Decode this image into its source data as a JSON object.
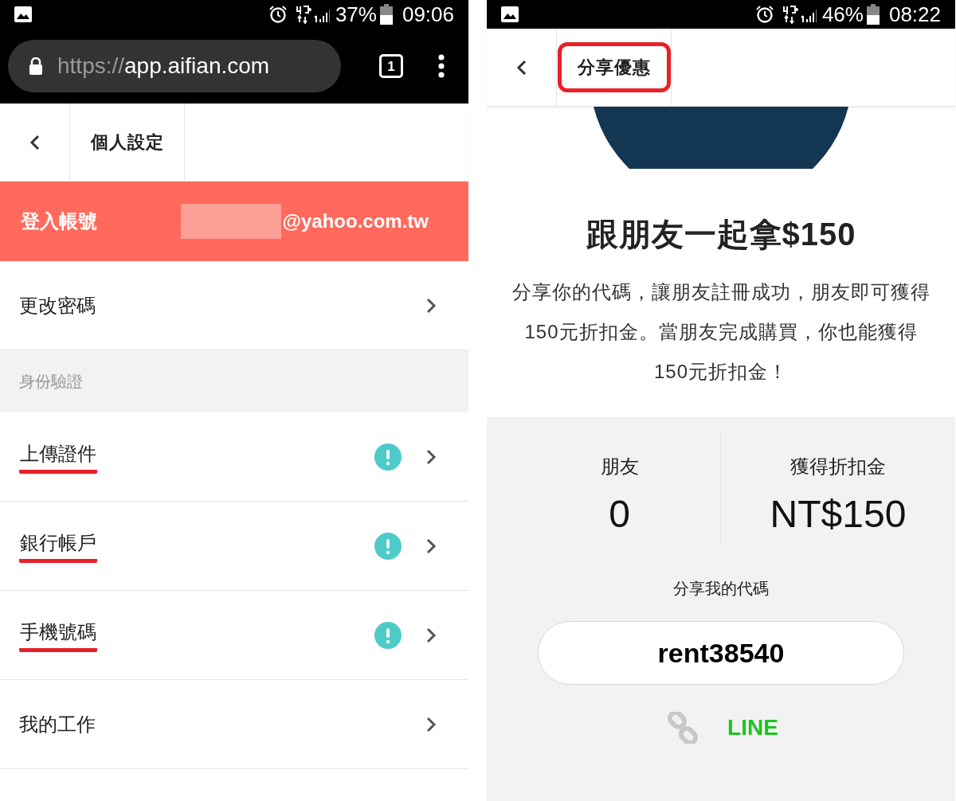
{
  "left_screen": {
    "status_bar": {
      "battery": "37%",
      "time": "09:06"
    },
    "browser": {
      "url": {
        "scheme": "https://",
        "host": "app.aifian.com"
      },
      "tab_count": "1"
    },
    "header": {
      "title": "個人設定"
    },
    "account": {
      "label": "登入帳號",
      "email": "@yahoo.com.tw"
    },
    "rows": [
      {
        "kind": "item",
        "label": "更改密碼",
        "alert": false,
        "underlined": false
      },
      {
        "kind": "section",
        "label": "身份驗證"
      },
      {
        "kind": "item",
        "label": "上傳證件",
        "alert": true,
        "underlined": true
      },
      {
        "kind": "item",
        "label": "銀行帳戶",
        "alert": true,
        "underlined": true
      },
      {
        "kind": "item",
        "label": "手機號碼",
        "alert": true,
        "underlined": true
      },
      {
        "kind": "item",
        "label": "我的工作",
        "alert": false,
        "underlined": false
      }
    ]
  },
  "right_screen": {
    "status_bar": {
      "battery": "46%",
      "time": "08:22"
    },
    "header": {
      "title": "分享優惠",
      "highlighted": true
    },
    "headline": "跟朋友一起拿$150",
    "description": "分享你的代碼，讓朋友註冊成功，朋友即可獲得150元折扣金。當朋友完成購買，你也能獲得150元折扣金！",
    "stats": [
      {
        "label": "朋友",
        "value": "0"
      },
      {
        "label": "獲得折扣金",
        "value": "NT$150"
      }
    ],
    "share_label": "分享我的代碼",
    "code": "rent38540",
    "share_options": [
      {
        "kind": "link"
      },
      {
        "kind": "line",
        "label": "LINE"
      }
    ]
  }
}
